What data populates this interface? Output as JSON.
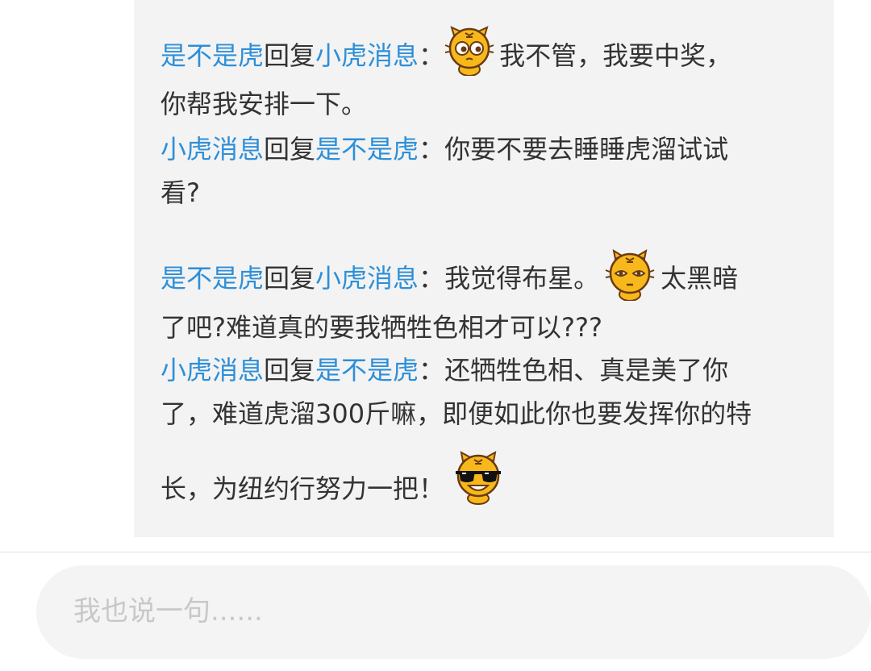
{
  "replies": [
    {
      "from": "是不是虎",
      "reply_word": "回复",
      "to": "小虎消息",
      "colon": "：",
      "emoji": "tiger-thinking-icon",
      "text_line1": "我不管，我要中奖，",
      "text_line2": "你帮我安排一下。"
    },
    {
      "from": "小虎消息",
      "reply_word": "回复",
      "to": "是不是虎",
      "colon": "：",
      "text_line1": "你要不要去睡睡虎溜试试",
      "text_line2": "看?"
    },
    {
      "from": "是不是虎",
      "reply_word": "回复",
      "to": "小虎消息",
      "colon": "：",
      "text_before_emoji": "我觉得布星。",
      "emoji": "tiger-speechless-icon",
      "text_after_emoji": "太黑暗",
      "text_line2": "了吧?难道真的要我牺牲色相才可以???"
    },
    {
      "from": "小虎消息",
      "reply_word": "回复",
      "to": "是不是虎",
      "colon": "：",
      "text_line1": "还牺牲色相、真是美了你",
      "text_line2": "了，难道虎溜300斤嘛，即便如此你也要发挥你的特",
      "text_line3": "长，为纽约行努力一把！",
      "emoji": "tiger-sunglasses-icon"
    }
  ],
  "input": {
    "placeholder": "我也说一句......"
  },
  "colors": {
    "username": "#2d8fd8",
    "text": "#333333",
    "panel_bg": "#f3f3f3",
    "placeholder": "#c8c8c8",
    "tiger_yellow": "#f7b81c"
  }
}
